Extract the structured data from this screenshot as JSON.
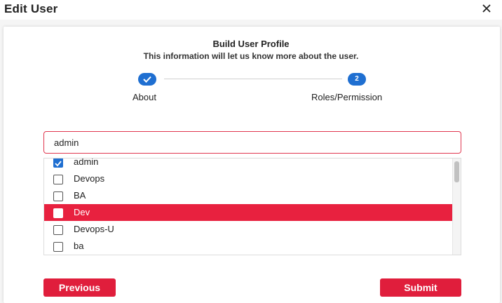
{
  "window": {
    "title": "Edit User"
  },
  "header": {
    "heading": "Build User Profile",
    "subheading": "This information will let us know more about the user."
  },
  "stepper": {
    "steps": [
      {
        "label": "About",
        "state": "completed",
        "number": ""
      },
      {
        "label": "Roles/Permission",
        "state": "active",
        "number": "2"
      }
    ]
  },
  "search": {
    "value": "admin",
    "placeholder": ""
  },
  "roles": {
    "items": [
      {
        "label": "admin",
        "checked": true,
        "highlighted": false
      },
      {
        "label": "Devops",
        "checked": false,
        "highlighted": false
      },
      {
        "label": "BA",
        "checked": false,
        "highlighted": false
      },
      {
        "label": "Dev",
        "checked": false,
        "highlighted": true
      },
      {
        "label": "Devops-U",
        "checked": false,
        "highlighted": false
      },
      {
        "label": "ba",
        "checked": false,
        "highlighted": false
      }
    ]
  },
  "actions": {
    "previous_label": "Previous",
    "submit_label": "Submit"
  },
  "colors": {
    "accent_red": "#e01e3c",
    "step_blue": "#1f6fd1"
  }
}
